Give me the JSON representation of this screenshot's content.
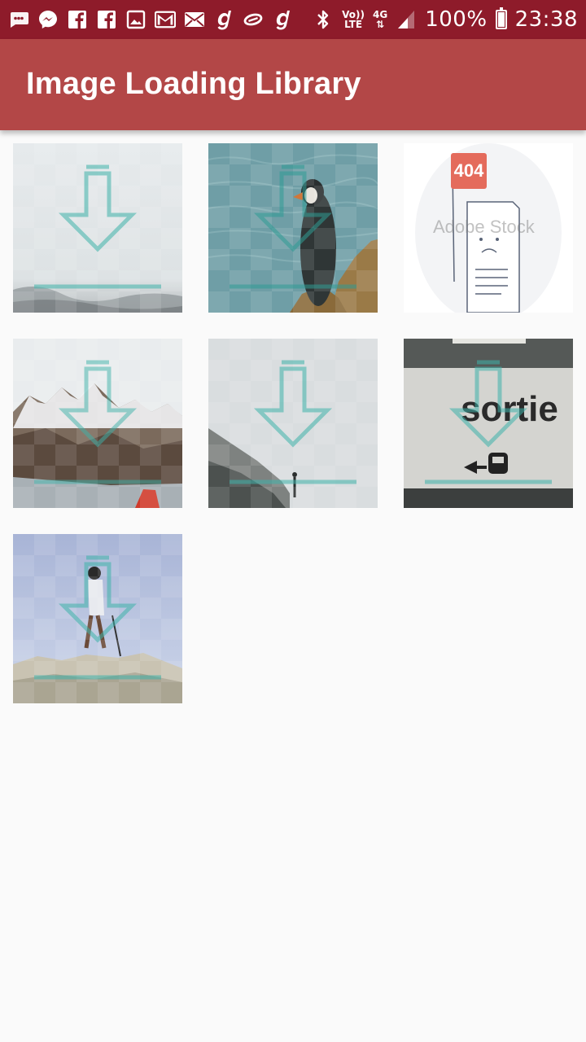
{
  "status_bar": {
    "left_icons": [
      "messages-icon",
      "messenger-icon",
      "facebook-icon",
      "facebook-icon",
      "gallery-icon",
      "gmail-icon",
      "email-icon",
      "g-app-icon",
      "circle-app-icon",
      "g-app-icon"
    ],
    "bluetooth_icon": "bluetooth-icon",
    "volte_label_top": "Vo))",
    "volte_label_bottom": "LTE",
    "network_label": "4G",
    "battery_percent": "100%",
    "time": "23:38"
  },
  "app_bar": {
    "title": "Image Loading Library",
    "color": "#b34747"
  },
  "grid": {
    "placeholder_icon": "download-arrow-icon",
    "tiles": [
      {
        "subject": "foggy-landscape"
      },
      {
        "subject": "puffin-on-rock"
      },
      {
        "subject": "404-not-found",
        "badge_text": "404",
        "watermark": "Adobe Stock"
      },
      {
        "subject": "snowy-mountains"
      },
      {
        "subject": "foggy-cliff"
      },
      {
        "subject": "parking-sortie-sign",
        "sign_text": "sortie"
      },
      {
        "subject": "hiker-on-rocks"
      }
    ]
  },
  "colors": {
    "status_bar": "#8e1b2a",
    "placeholder_teal": "#3fb3aa",
    "background": "#fafafa"
  }
}
